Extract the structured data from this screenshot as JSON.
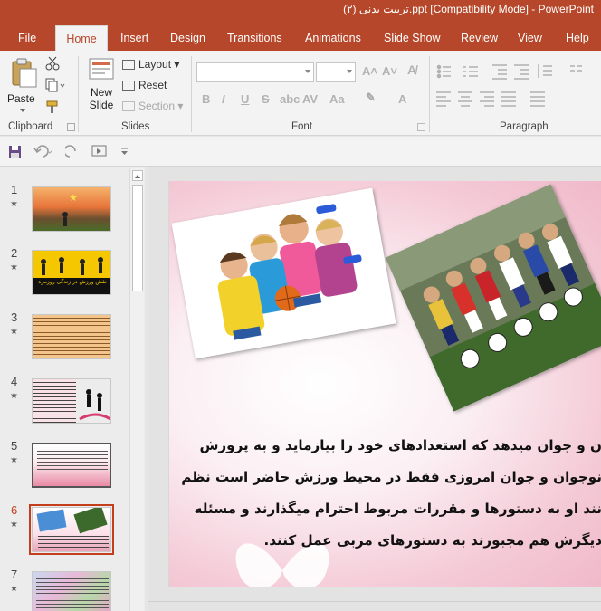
{
  "window": {
    "title": "تربیت بدنی (۲).ppt [Compatibility Mode] - PowerPoint"
  },
  "tabs": [
    "File",
    "Home",
    "Insert",
    "Design",
    "Transitions",
    "Animations",
    "Slide Show",
    "Review",
    "View",
    "Help"
  ],
  "active_tab": "Home",
  "ribbon": {
    "clipboard": {
      "paste_label": "Paste",
      "group_label": "Clipboard"
    },
    "slides": {
      "new_slide_line1": "New",
      "new_slide_line2": "Slide",
      "layout_label": "Layout",
      "reset_label": "Reset",
      "section_label": "Section",
      "group_label": "Slides"
    },
    "font": {
      "font_name_value": "",
      "font_size_value": "",
      "bold": "B",
      "italic": "I",
      "underline": "U",
      "strike": "S",
      "group_label": "Font"
    },
    "paragraph": {
      "group_label": "Paragraph"
    }
  },
  "slides_panel": {
    "slides": [
      {
        "number": "1",
        "star": "★",
        "active": false
      },
      {
        "number": "2",
        "star": "★",
        "active": false
      },
      {
        "number": "3",
        "star": "★",
        "active": false
      },
      {
        "number": "4",
        "star": "★",
        "active": false
      },
      {
        "number": "5",
        "star": "★",
        "active": false
      },
      {
        "number": "6",
        "star": "★",
        "active": true
      },
      {
        "number": "7",
        "star": "★",
        "active": false
      }
    ],
    "thumb2_caption": "نقش ورزش در زندگی روزمره"
  },
  "current_slide": {
    "text_lines": [
      "ن و جوان میدهد که استعدادهای خود را بیازماید و به پرورش",
      "نوجوان و جوان امروزی فقط در محیط ورزش حاضر است نظم",
      "ٍنند او به دستورها و مقررات مربوط احترام میگذارند و مسئله",
      "دیگرش هم مجبورند به دستورهای مربی عمل کنند."
    ]
  },
  "colors": {
    "accent": "#b7472a",
    "active_slide": "#c43e1c",
    "ribbon_bg": "#f3f3f3"
  }
}
